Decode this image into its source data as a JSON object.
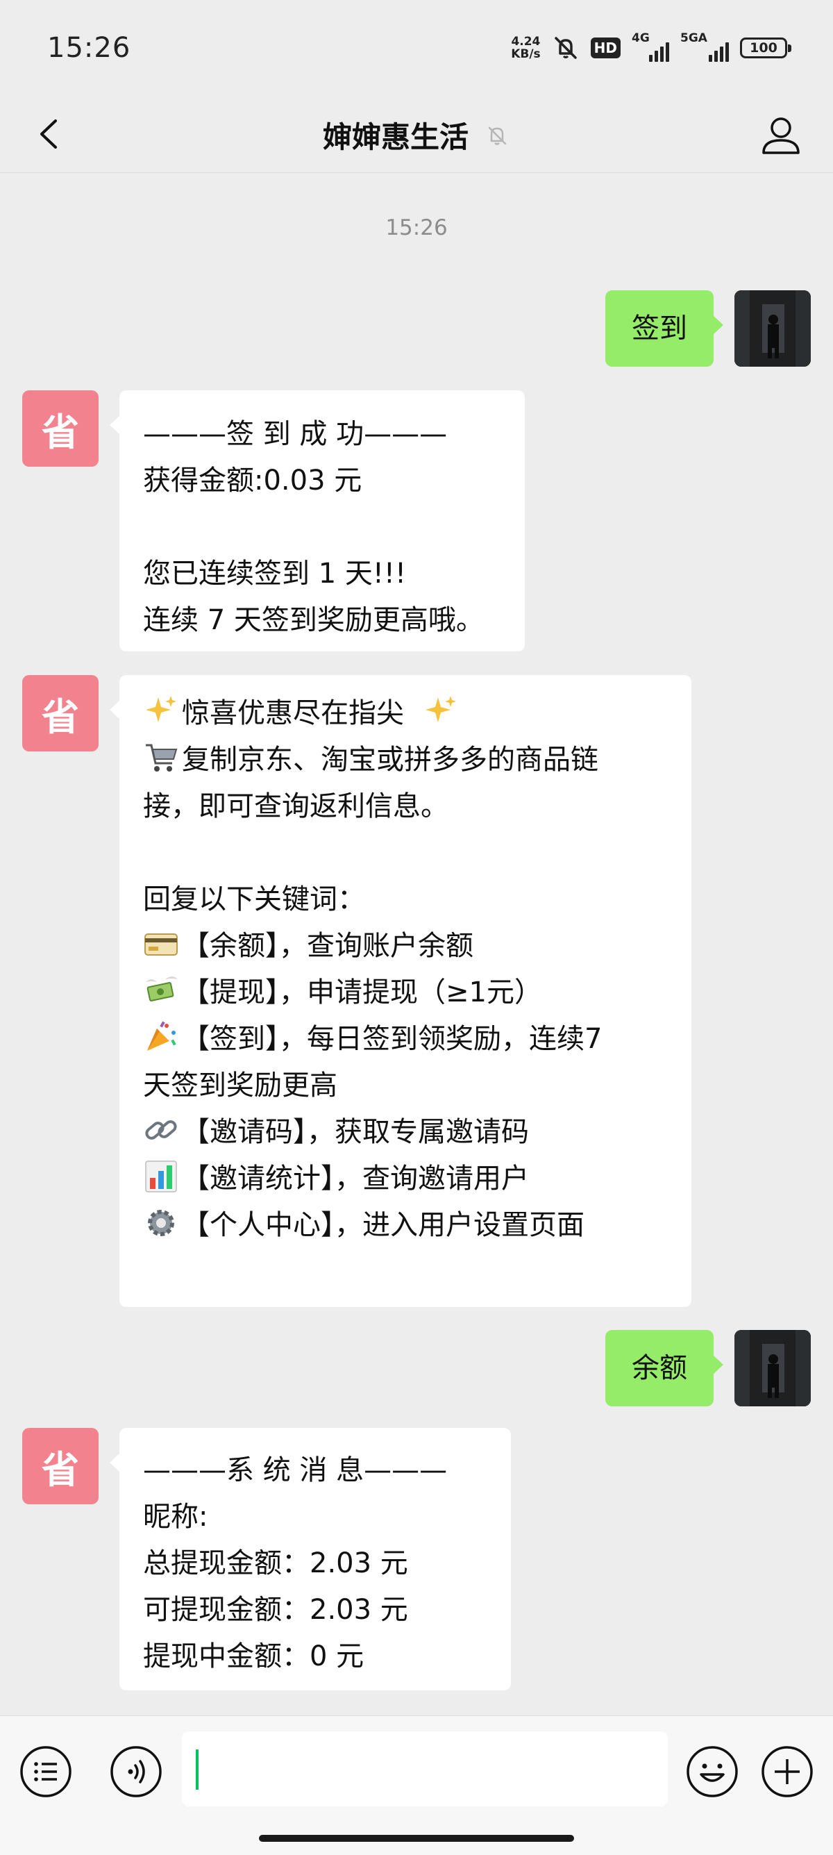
{
  "status_bar": {
    "time": "15:26",
    "net_speed_value": "4.24",
    "net_speed_unit": "KB/s",
    "hd_label": "HD",
    "signal1_label": "4G",
    "signal2_label": "5GA",
    "battery": "100"
  },
  "header": {
    "title": "婶婶惠生活"
  },
  "timestamp": "15:26",
  "bot_avatar_char": "省",
  "messages": {
    "m1": {
      "text": "签到"
    },
    "m2": {
      "lines": [
        "———签 到 成 功———",
        "获得金额:0.03 元",
        "",
        "您已连续签到 1 天!!!",
        "连续 7 天签到奖励更高哦。"
      ]
    },
    "m3": {
      "l1": "惊喜优惠尽在指尖",
      "l2": "复制京东、淘宝或拼多多的商品链",
      "l3": "接，即可查询返利信息。",
      "l4": "回复以下关键词：",
      "l5": "【余额】，查询账户余额",
      "l6": "【提现】，申请提现（≥1元）",
      "l7": "【签到】，每日签到领奖励，连续7",
      "l8": "天签到奖励更高",
      "l9": "【邀请码】，获取专属邀请码",
      "l10": "【邀请统计】，查询邀请用户",
      "l11": "【个人中心】，进入用户设置页面"
    },
    "m4": {
      "text": "余额"
    },
    "m5": {
      "lines": [
        "———系 统 消 息———",
        "昵称:",
        "总提现金额：2.03 元",
        "可提现金额：2.03 元",
        "提现中金额：0 元"
      ]
    }
  },
  "colors": {
    "bot_avatar": "#f3828f",
    "user_bubble": "#95ec69",
    "cursor": "#07c160"
  }
}
